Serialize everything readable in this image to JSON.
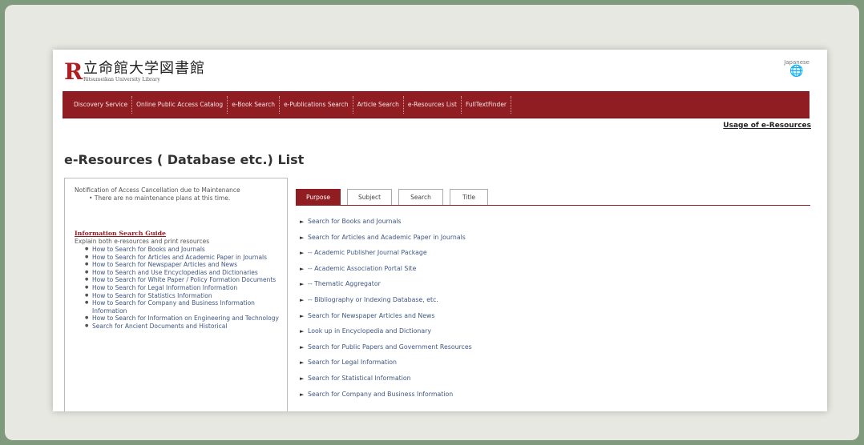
{
  "header": {
    "logo_letter": "R",
    "logo_main": "立命館大学図書館",
    "logo_sub": "Ritsumeikan University Library",
    "language_label": "Japanese",
    "globe_glyph": "🌐"
  },
  "nav": {
    "items": [
      "Discovery Service",
      "Online Public Access Catalog",
      "e-Book Search",
      "e-Publications Search",
      "Article Search",
      "e-Resources List",
      "FullTextFinder"
    ]
  },
  "usage_link": "Usage of e-Resources",
  "page_title": "e-Resources ( Database etc.) List",
  "notice": {
    "title": "Notification of Access Cancellation due to Maintenance",
    "item": "There are no maintenance plans at this time."
  },
  "guide": {
    "heading": "Information Search Guide",
    "subtitle": "Explain both e-resources and print resources",
    "items": [
      "How to Search for Books and Journals",
      "How to Search for Articles and Academic Paper in Journals",
      "How to Search for Newspaper Articles and News",
      "How to Search and Use Encyclopedias and Dictionaries",
      "How to Search for White Paper / Policy Formation Documents",
      "How to Search for Legal Information Information",
      "How to Search for Statistics Information",
      "How to Search for Company and Business Information Information",
      "How to Search for Information on Engineering and Technology",
      "Search for Ancient Documents and Historical"
    ]
  },
  "tabs": [
    {
      "label": "Purpose",
      "active": true
    },
    {
      "label": "Subject",
      "active": false
    },
    {
      "label": "Search",
      "active": false
    },
    {
      "label": "Title",
      "active": false
    }
  ],
  "purpose_items": [
    "Search for Books and Journals",
    "Search for Articles and Academic Paper in Journals",
    "-- Academic Publisher Journal Package",
    "-- Academic Association Portal Site",
    "-- Thematic Aggregator",
    "-- Bibliography or Indexing Database, etc.",
    "Search for Newspaper Articles and News",
    "Look up in Encyclopedia and Dictionary",
    "Search for Public Papers and Government Resources",
    "Search for Legal Information",
    "Search for Statistical Information",
    "Search for Company and Business Information"
  ],
  "arrow_glyph": "►",
  "colors": {
    "brand_red": "#8f1d22",
    "link_blue": "#3f5680"
  }
}
